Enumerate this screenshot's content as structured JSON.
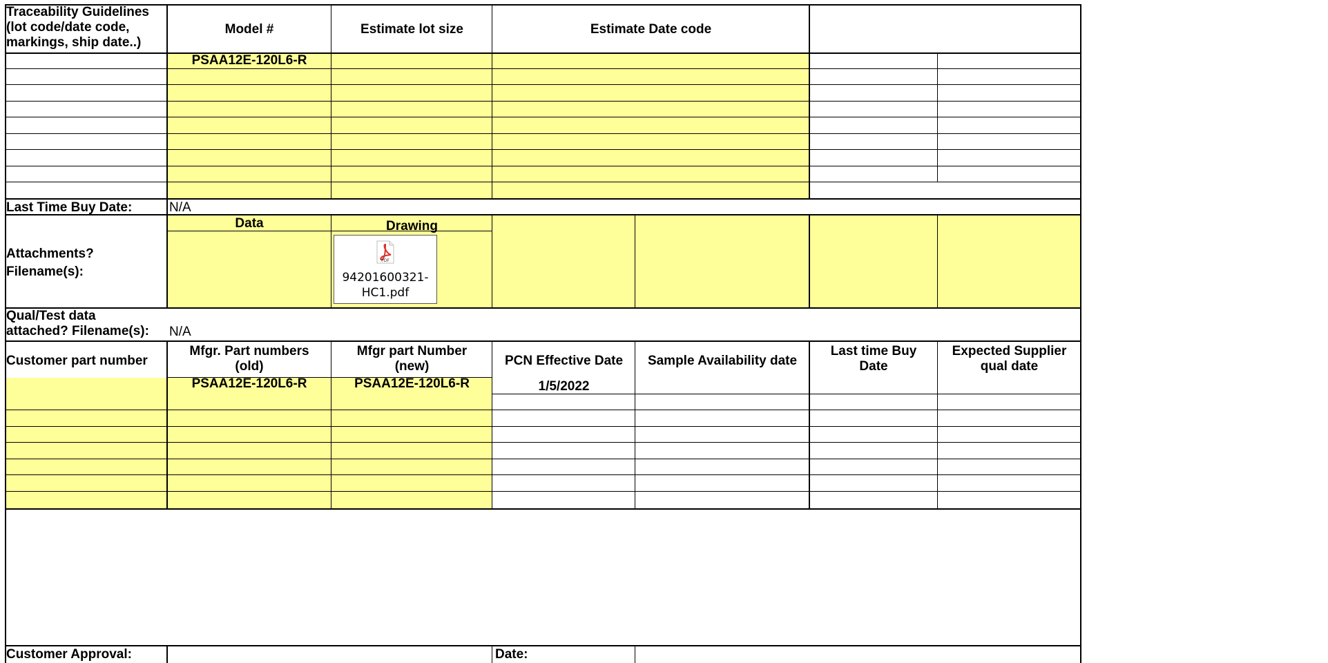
{
  "traceability": {
    "guidelines_lines": [
      "Traceability Guidelines",
      "(lot code/date code,",
      "markings, ship date..)"
    ],
    "col_model": "Model #",
    "col_lot": "Estimate lot size",
    "col_date": "Estimate Date code",
    "model_value": "PSAA12E-120L6-R"
  },
  "ltb": {
    "label": "Last Time Buy Date:",
    "value": "N/A"
  },
  "attachments": {
    "label_lines": [
      "Attachments?",
      "Filename(s):"
    ],
    "col_data": "Data",
    "col_drawing": "Drawing",
    "file_icon": "pdf-file-icon",
    "file_icon_text": "PDF",
    "file_name_lines": [
      "94201600321-",
      "HC1.pdf"
    ]
  },
  "qual": {
    "label_lines": [
      "Qual/Test data",
      "attached? Filename(s):"
    ],
    "value": "N/A"
  },
  "parts": {
    "h_customer": "Customer part number",
    "h_old": [
      "Mfgr. Part numbers",
      "(old)"
    ],
    "h_new": [
      "Mfgr part Number",
      "(new)"
    ],
    "h_pcn": "PCN Effective Date",
    "h_sample": "Sample Availability date",
    "h_ltb": [
      "Last time Buy",
      "Date"
    ],
    "h_qual": [
      "Expected Supplier",
      "qual date"
    ],
    "row1": {
      "old": "PSAA12E-120L6-R",
      "new": "PSAA12E-120L6-R",
      "pcn": "1/5/2022"
    }
  },
  "approval": {
    "label": "Customer Approval:",
    "date_label": "Date:"
  },
  "colors": {
    "yellow": "#ffff99",
    "grid": "#000000",
    "pdf_red": "#d9322b"
  }
}
